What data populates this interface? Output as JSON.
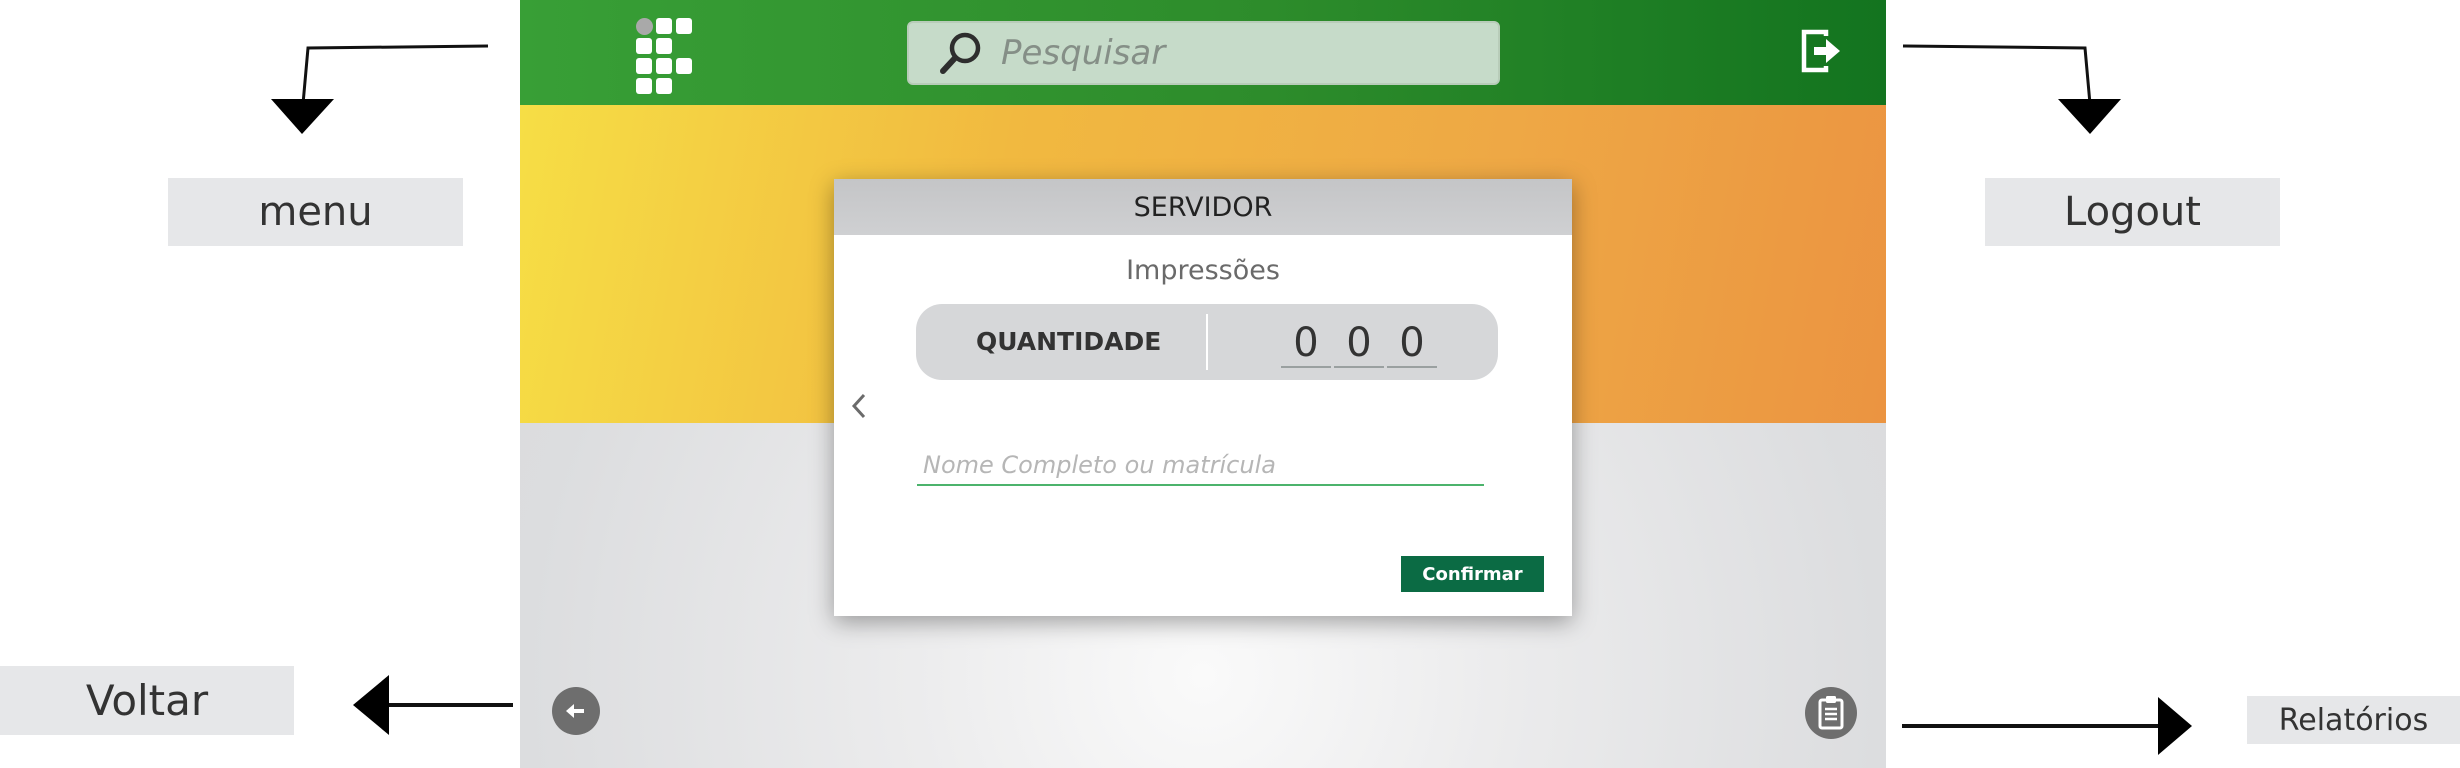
{
  "annotations": {
    "menu": "menu",
    "logout": "Logout",
    "voltar": "Voltar",
    "relatorios": "Relatórios"
  },
  "header": {
    "search_placeholder": "Pesquisar",
    "icons": [
      "logo-icon",
      "search-icon",
      "logout-icon"
    ]
  },
  "card": {
    "title": "SERVIDOR",
    "subtitle": "Impressões",
    "quantity_label": "QUANTIDADE",
    "digits": [
      "0",
      "0",
      "0"
    ],
    "name_placeholder": "Nome Completo ou matrícula",
    "confirm_label": "Confirmar"
  },
  "footer": {
    "icons": [
      "back-arrow-icon",
      "clipboard-icon"
    ]
  },
  "colors": {
    "topbar": "#2d8c2b",
    "hero_start": "#f6de45",
    "hero_end": "#eb9441",
    "confirm": "#0b6b44",
    "field_underline": "#4cb36c"
  }
}
